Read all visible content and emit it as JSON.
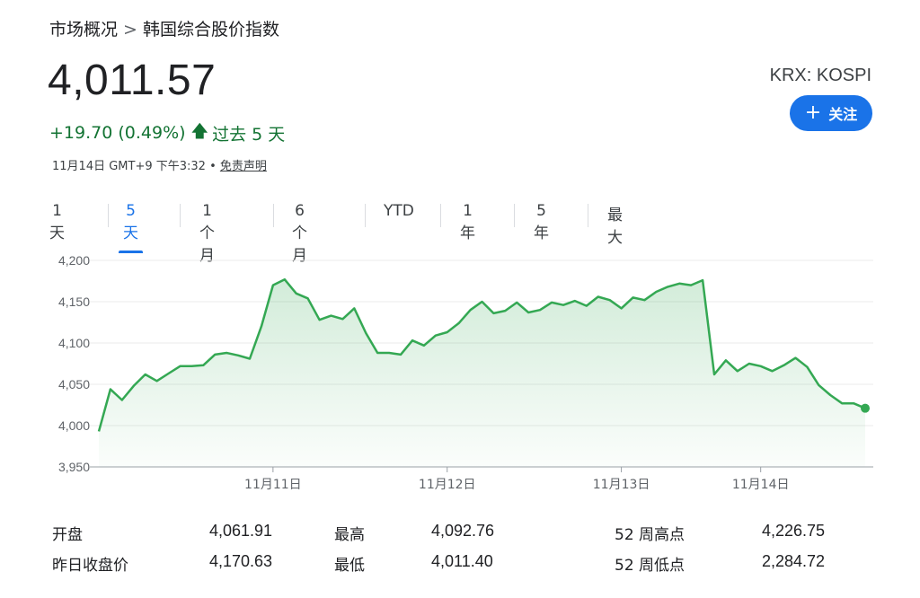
{
  "breadcrumb": {
    "parent": "市场概况",
    "separator": ">",
    "current": "韩国综合股价指数"
  },
  "quote": {
    "price": "4,011.57",
    "change": "+19.70 (0.49%)",
    "change_icon": "arrow-up-icon",
    "period": "过去 5 天",
    "timestamp": "11月14日 GMT+9 下午3:32 • ",
    "disclaimer": "免责声明",
    "ticker": "KRX: KOSPI",
    "up_color": "#137333"
  },
  "follow": {
    "icon": "+",
    "label": "关注",
    "color": "#1a73e8"
  },
  "tabs": [
    "1 天",
    "5 天",
    "1 个月",
    "6 个月",
    "YTD",
    "1 年",
    "5 年",
    "最大"
  ],
  "active_tab": "5 天",
  "chart_data": {
    "type": "area",
    "color": "#34a853",
    "ylim": [
      3950,
      4200
    ],
    "y_ticks": [
      3950,
      4000,
      4050,
      4100,
      4150,
      4200
    ],
    "y_tick_labels": [
      "3,950",
      "4,000",
      "4,050",
      "4,100",
      "4,150",
      "4,200"
    ],
    "x_ticks": [
      "11月11日",
      "11月12日",
      "11月13日",
      "11月14日"
    ],
    "x_tick_index": [
      15,
      30,
      45,
      57
    ],
    "grid": true,
    "series": [
      {
        "values": [
          3993,
          4044,
          4031,
          4048,
          4062,
          4054,
          4063,
          4072,
          4072,
          4073,
          4086,
          4088,
          4085,
          4081,
          4120,
          4170,
          4177,
          4160,
          4154,
          4128,
          4133,
          4129,
          4142,
          4112,
          4088,
          4088,
          4086,
          4103,
          4097,
          4109,
          4113,
          4124,
          4140,
          4150,
          4136,
          4139,
          4149,
          4137,
          4140,
          4149,
          4146,
          4151,
          4145,
          4156,
          4152,
          4142,
          4155,
          4152,
          4162,
          4168,
          4172,
          4170,
          4176,
          4062,
          4079,
          4066,
          4075,
          4072,
          4066,
          4073,
          4082,
          4071,
          4049,
          4037,
          4027,
          4027,
          4021
        ]
      }
    ]
  },
  "stats": [
    {
      "label": "开盘",
      "value": "4,061.91",
      "label2": "最高",
      "value2": "4,092.76",
      "label3": "52 周高点",
      "value3": "4,226.75"
    },
    {
      "label": "昨日收盘价",
      "value": "4,170.63",
      "label2": "最低",
      "value2": "4,011.40",
      "label3": "52 周低点",
      "value3": "2,284.72"
    }
  ]
}
